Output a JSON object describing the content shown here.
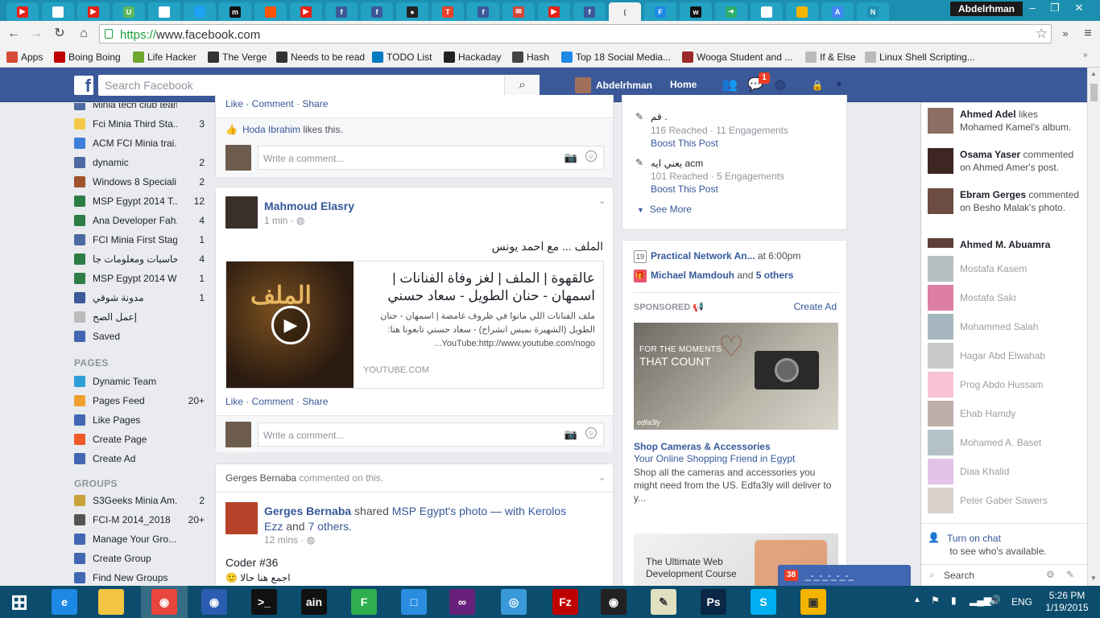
{
  "browser": {
    "user_name": "Abdelrhman",
    "url_scheme": "https://",
    "url_rest": "www.facebook.com",
    "tabs": [
      {
        "icon": "youtube-icon",
        "color": "#e62117",
        "glyph": "▶"
      },
      {
        "icon": "page-icon",
        "color": "#ffffff",
        "glyph": ""
      },
      {
        "icon": "youtube-icon",
        "color": "#e62117",
        "glyph": "▶"
      },
      {
        "icon": "u-icon",
        "color": "#5cb85c",
        "glyph": "U"
      },
      {
        "icon": "page-icon",
        "color": "#ffffff",
        "glyph": ""
      },
      {
        "icon": "twitter-icon",
        "color": "#1da1f2",
        "glyph": ""
      },
      {
        "icon": "m-icon",
        "color": "#111111",
        "glyph": "m"
      },
      {
        "icon": "soundcloud-icon",
        "color": "#ff5500",
        "glyph": ""
      },
      {
        "icon": "youtube-icon",
        "color": "#e62117",
        "glyph": "▶"
      },
      {
        "icon": "facebook-icon",
        "color": "#3b5998",
        "glyph": "f"
      },
      {
        "icon": "facebook-icon",
        "color": "#3b5998",
        "glyph": "f"
      },
      {
        "icon": "github-icon",
        "color": "#222222",
        "glyph": "●"
      },
      {
        "icon": "t-icon",
        "color": "#e8402a",
        "glyph": "T"
      },
      {
        "icon": "facebook-icon",
        "color": "#3b5998",
        "glyph": "f"
      },
      {
        "icon": "mail-icon",
        "color": "#d44638",
        "glyph": "✉"
      },
      {
        "icon": "youtube-icon",
        "color": "#e62117",
        "glyph": "▶"
      },
      {
        "icon": "facebook-icon",
        "color": "#3b5998",
        "glyph": "f"
      },
      {
        "icon": "loading-icon",
        "color": "#f2f2f2",
        "glyph": "("
      },
      {
        "icon": "f-icon",
        "color": "#1e88e5",
        "glyph": "F"
      },
      {
        "icon": "w-icon",
        "color": "#111111",
        "glyph": "w"
      },
      {
        "icon": "arrow-icon",
        "color": "#2eae6b",
        "glyph": "➜"
      },
      {
        "icon": "page-icon",
        "color": "#ffffff",
        "glyph": ""
      },
      {
        "icon": "store-icon",
        "color": "#f4b400",
        "glyph": ""
      },
      {
        "icon": "translate-icon",
        "color": "#4285f4",
        "glyph": "A"
      },
      {
        "icon": "n-icon",
        "color": "#1c8fb0",
        "glyph": "N"
      }
    ],
    "bookmarks": [
      {
        "label": "Apps",
        "icon": "apps-grid-icon",
        "color": "#d84a38"
      },
      {
        "label": "Boing Boing",
        "icon": "bb-icon",
        "color": "#c00000"
      },
      {
        "label": "Life Hacker",
        "icon": "lh-icon",
        "color": "#6fa82e"
      },
      {
        "label": "The Verge",
        "icon": "verge-icon",
        "color": "#333333"
      },
      {
        "label": "Needs to be read",
        "icon": "i-icon",
        "color": "#333333"
      },
      {
        "label": "TODO List",
        "icon": "trello-icon",
        "color": "#0079bf"
      },
      {
        "label": "Hackaday",
        "icon": "hackaday-icon",
        "color": "#222222"
      },
      {
        "label": "Hash",
        "icon": "rs-icon",
        "color": "#444444"
      },
      {
        "label": "Top 18 Social Media...",
        "icon": "m-blue-icon",
        "color": "#1e88e5"
      },
      {
        "label": "Wooga Student and ...",
        "icon": "wooga-icon",
        "color": "#9b2a2a"
      },
      {
        "label": "If & Else",
        "icon": "page-icon",
        "color": "#bbbbbb"
      },
      {
        "label": "Linux Shell Scripting...",
        "icon": "page-icon",
        "color": "#bbbbbb"
      }
    ]
  },
  "fb": {
    "search_placeholder": "Search Facebook",
    "user": "Abdelrhman",
    "home": "Home",
    "notif_count": "1"
  },
  "leftnav": {
    "top_items": [
      {
        "label": "Minia tech club team",
        "count": "",
        "color": "#4e69a2"
      },
      {
        "label": "Fci Minia Third Sta...",
        "count": "3",
        "color": "#f7c948"
      },
      {
        "label": "ACM FCI Minia trai...",
        "count": "",
        "color": "#3b7dd8"
      },
      {
        "label": "dynamic",
        "count": "2",
        "color": "#4e69a2"
      },
      {
        "label": "Windows 8 Speciali...",
        "count": "2",
        "color": "#a0522d"
      },
      {
        "label": "MSP Egypt 2014 T...",
        "count": "12",
        "color": "#2d7d46"
      },
      {
        "label": "Ana Developer Fah...",
        "count": "4",
        "color": "#2d7d46"
      },
      {
        "label": "FCI Minia First Stag...",
        "count": "1",
        "color": "#4e69a2"
      },
      {
        "label": "كلية حاسبات ومعلومات جا...",
        "count": "4",
        "color": "#2d7d46"
      },
      {
        "label": "MSP Egypt 2014 W...",
        "count": "1",
        "color": "#2d7d46"
      },
      {
        "label": "مدونة شوقي",
        "count": "1",
        "color": "#3b5998"
      },
      {
        "label": "إعمل الصح",
        "count": "",
        "color": "#bbbbbb"
      },
      {
        "label": "Saved",
        "count": "",
        "color": "#4267b2"
      }
    ],
    "pages_header": "PAGES",
    "pages": [
      {
        "label": "Dynamic Team",
        "count": "",
        "color": "#2e9fd8"
      },
      {
        "label": "Pages Feed",
        "count": "20+",
        "color": "#f0a030"
      },
      {
        "label": "Like Pages",
        "count": "",
        "color": "#4267b2"
      },
      {
        "label": "Create Page",
        "count": "",
        "color": "#f05a28"
      },
      {
        "label": "Create Ad",
        "count": "",
        "color": "#4267b2"
      }
    ],
    "groups_header": "GROUPS",
    "groups": [
      {
        "label": "S3Geeks Minia Am...",
        "count": "2",
        "color": "#c8a23b"
      },
      {
        "label": "FCI-M 2014_2018",
        "count": "20+",
        "color": "#555555"
      },
      {
        "label": "Manage Your Gro...",
        "count": "",
        "color": "#4267b2"
      },
      {
        "label": "Create Group",
        "count": "",
        "color": "#4267b2"
      },
      {
        "label": "Find New Groups",
        "count": "",
        "color": "#4267b2"
      }
    ]
  },
  "feed": {
    "top_actions": "Like · Comment · Share",
    "hoda_name": "Hoda Ibrahim",
    "hoda_likes": " likes this.",
    "comment_placeholder": "Write a comment...",
    "post1": {
      "author": "Mahmoud Elasry",
      "time": "1 min",
      "text": "الملف ... مع احمد يونس",
      "link_title": "عالقهوة | الملف | لغز وفاة الفنانات | اسمهان - حنان الطويل - سعاد حسني",
      "link_desc": "ملف الفنانات اللي ماتوا في ظروف غامضة | اسمهان - حنان الطويل (الشهيرة بميس انشراح) - سعاد حسني تابعونا هنا: YouTube:http://www.youtube.com/nogo...",
      "link_domain": "YOUTUBE.COM",
      "thumb_title": "الملف",
      "actions": "Like · Comment · Share"
    },
    "post2": {
      "header_name": "Gerges Bernaba",
      "header_rest": " commented on this.",
      "author": "Gerges Bernaba",
      "shared": " shared ",
      "page": "MSP Egypt",
      "photo": "'s photo — with ",
      "tagged": "Kerolos Ezz",
      "and": " and ",
      "others": "7 others.",
      "time": "12 mins",
      "text": "Coder #36",
      "text2": "اجمع هنا حالا 🙂"
    }
  },
  "rightcol": {
    "post_a_title": "قم .",
    "post_a_stats": "116 Reached · 11 Engagements",
    "boost": "Boost This Post",
    "post_b_title": "يعني ايه acm",
    "post_b_stats": "101 Reached · 5 Engagements",
    "see_more": "See More",
    "event1_name": "Practical Network An...",
    "event1_time": " at 6:00pm",
    "calendar_day": "19",
    "birthday_name": "Michael Mamdouh",
    "birthday_rest": " and ",
    "birthday_others": "5 others",
    "sponsored": "SPONSORED",
    "create_ad": "Create Ad",
    "ad_image_line1": "FOR THE MOMENTS",
    "ad_image_line2": "THAT COUNT",
    "ad_image_brand": "edfa3ly",
    "ad_title": "Shop Cameras & Accessories",
    "ad_subtitle": "Your Online Shopping Friend in Egypt",
    "ad_text": "Shop all the cameras and accessories you might need from the US. Edfa3ly will deliver to y...",
    "ad2_line1": "The Ultimate Web",
    "ad2_line2": "Development Course"
  },
  "chat": {
    "ticker": [
      {
        "name": "Ahmed Adel",
        "rest": " likes Mohamed Kamel's album.",
        "color": "#8d6e63"
      },
      {
        "name": "Osama Yaser",
        "rest": " commented on Ahmed Amer's post.",
        "color": "#3e2723"
      },
      {
        "name": "Ebram Gerges",
        "rest": " commented on Besho Malak's photo.",
        "color": "#6d4c41"
      },
      {
        "name": "Ahmed M. Abuamra",
        "rest": "",
        "color": "#5d4037"
      }
    ],
    "contacts": [
      {
        "name": "Mostafa Kasem",
        "color": "#7b8a8b"
      },
      {
        "name": "Mostafa Sakr",
        "color": "#c2185b"
      },
      {
        "name": "Mohammed Salah",
        "color": "#607d8b"
      },
      {
        "name": "Hagar Abd Elwahab",
        "color": "#9e9e9e"
      },
      {
        "name": "Prog Abdo Hussam",
        "color": "#f48fb1"
      },
      {
        "name": "Ehab Hamdy",
        "color": "#8d6e63"
      },
      {
        "name": "Mohamed A. Baset",
        "color": "#78909c"
      },
      {
        "name": "Diaa Khalid",
        "color": "#ce93d8"
      },
      {
        "name": "Peter Gaber Sawers",
        "color": "#bcaaa4"
      }
    ],
    "turn_on": "Turn on chat",
    "turn_on_rest": " to see who's available.",
    "search_placeholder": "Search",
    "popup_count": "38",
    "popup_title": "_-_-_-_-_-_"
  },
  "taskbar": {
    "icons": [
      {
        "name": "windows-start-icon",
        "color": "#0c4c6c",
        "glyph": "⊞"
      },
      {
        "name": "internet-explorer-icon",
        "color": "#1e88e5",
        "glyph": "e"
      },
      {
        "name": "file-explorer-icon",
        "color": "#f4c542",
        "glyph": ""
      },
      {
        "name": "chrome-icon",
        "color": "#e8453c",
        "glyph": "◉"
      },
      {
        "name": "firefox-icon",
        "color": "#2a5db0",
        "glyph": "◉"
      },
      {
        "name": "terminal-icon",
        "color": "#111111",
        "glyph": ">_"
      },
      {
        "name": "cain-icon",
        "color": "#111111",
        "glyph": "ain"
      },
      {
        "name": "green-app-icon",
        "color": "#2eae4e",
        "glyph": "F"
      },
      {
        "name": "box-app-icon",
        "color": "#2a8de0",
        "glyph": "□"
      },
      {
        "name": "visual-studio-icon",
        "color": "#68217a",
        "glyph": "∞"
      },
      {
        "name": "network-globe-icon",
        "color": "#3a9ad9",
        "glyph": "◎"
      },
      {
        "name": "filezilla-icon",
        "color": "#bf0000",
        "glyph": "Fz"
      },
      {
        "name": "eye-app-icon",
        "color": "#222222",
        "glyph": "◉"
      },
      {
        "name": "notepad-icon",
        "color": "#e0e0c0",
        "glyph": "✎"
      },
      {
        "name": "photoshop-icon",
        "color": "#0a2747",
        "glyph": "Ps"
      },
      {
        "name": "skype-icon",
        "color": "#00aff0",
        "glyph": "S"
      },
      {
        "name": "office-icon",
        "color": "#f4b400",
        "glyph": "▣"
      }
    ],
    "language": "ENG",
    "time": "5:26 PM",
    "date": "1/19/2015"
  }
}
